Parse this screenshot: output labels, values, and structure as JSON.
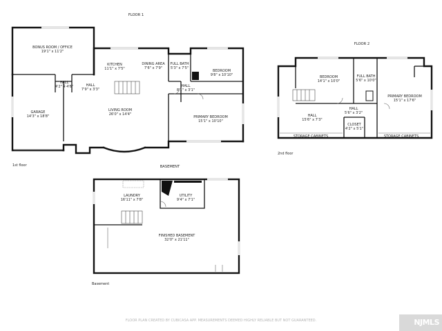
{
  "titles": {
    "floor1": "FLOOR 1",
    "floor2": "FLOOR 2",
    "basement": "BASEMENT"
  },
  "captions": {
    "floor1": "1st floor",
    "floor2": "2nd floor",
    "basement": "Basement"
  },
  "rooms": {
    "bonus": {
      "name": "BONUS ROOM / OFFICE",
      "dim": "19'1\" x 11'2\""
    },
    "garage": {
      "name": "GARAGE",
      "dim": "14'3\" x 18'8\""
    },
    "hall1a": {
      "name": "HALL",
      "dim": "4'2\" x 4'6\""
    },
    "hall1b": {
      "name": "HALL",
      "dim": "7'9\" x 3'3\""
    },
    "kitchen": {
      "name": "KITCHEN",
      "dim": "11'1\" x 7'5\""
    },
    "dining": {
      "name": "DINING AREA",
      "dim": "7'6\" x 7'9\""
    },
    "fullbath1": {
      "name": "FULL BATH",
      "dim": "5'3\" x 7'5\""
    },
    "bedroom1": {
      "name": "BEDROOM",
      "dim": "9'8\" x 10'10\""
    },
    "hall1c": {
      "name": "HALL",
      "dim": "8'1\" x 3'1\""
    },
    "living": {
      "name": "LIVING ROOM",
      "dim": "26'0\" x 14'4\""
    },
    "primary1": {
      "name": "PRIMARY BEDROOM",
      "dim": "15'1\" x 10'10\""
    },
    "bedroom2": {
      "name": "BEDROOM",
      "dim": "14'1\" x 10'0\""
    },
    "fullbath2": {
      "name": "FULL BATH",
      "dim": "5'6\" x 10'0\""
    },
    "primary2": {
      "name": "PRIMARY BEDROOM",
      "dim": "15'1\" x 17'6\""
    },
    "hall2a": {
      "name": "HALL",
      "dim": "15'6\" x 7'3\""
    },
    "hall2b": {
      "name": "HALL",
      "dim": "5'6\" x 3'2\""
    },
    "closet": {
      "name": "CLOSET",
      "dim": "4'2\" x 5'1\""
    },
    "storage_left": {
      "name": "STORAGE CABINETS"
    },
    "storage_right": {
      "name": "STORAGE CABINETS"
    },
    "laundry": {
      "name": "LAUNDRY",
      "dim": "16'11\" x 7'8\""
    },
    "utility": {
      "name": "UTILITY",
      "dim": "9'4\" x 7'1\""
    },
    "finished": {
      "name": "FINISHED BASEMENT",
      "dim": "32'0\" x 21'11\""
    }
  },
  "footer": "FLOOR PLAN CREATED BY CUBICASA APP. MEASUREMENTS DEEMED HIGHLY RELIABLE BUT NOT GUARANTEED.",
  "logo": "NJMLS",
  "colors": {
    "wall": "#111111",
    "text": "#222222",
    "footer": "#b4b4b4",
    "logo_bg": "#d9d9d9"
  }
}
